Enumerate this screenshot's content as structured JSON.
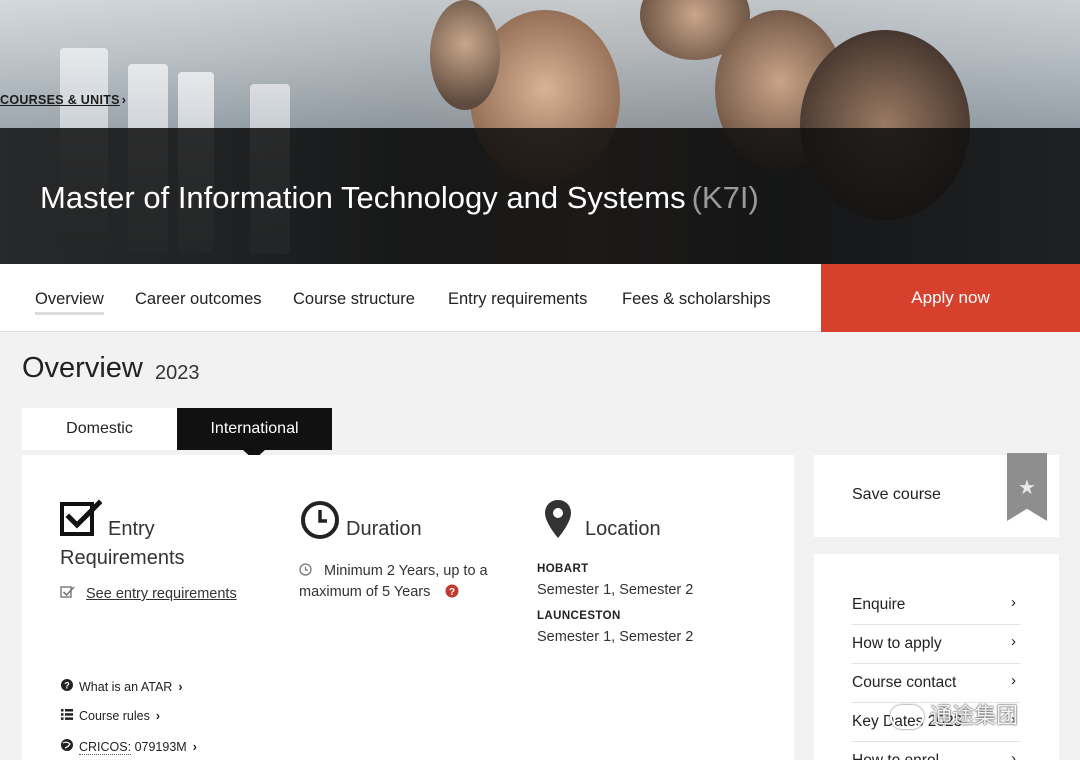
{
  "hero": {
    "breadcrumb": "COURSES & UNITS",
    "breadcrumb_chevron": "›",
    "title": "Master of Information Technology and Systems",
    "code": "(K7I)"
  },
  "nav": {
    "items": [
      "Overview",
      "Career outcomes",
      "Course structure",
      "Entry requirements",
      "Fees & scholarships"
    ],
    "apply_label": "Apply now"
  },
  "overview": {
    "title": "Overview",
    "year": "2023",
    "tabs": {
      "domestic": "Domestic",
      "international": "International"
    },
    "entry": {
      "title_line1": "Entry",
      "title_line2": "Requirements",
      "link": "See entry requirements",
      "icon": "checkbox-icon"
    },
    "duration": {
      "title": "Duration",
      "text_line1": "Minimum 2 Years, up to a",
      "text_line2": "maximum of 5 Years",
      "icon": "clock-icon"
    },
    "location": {
      "title": "Location",
      "icon": "map-pin-icon",
      "campuses": [
        {
          "name": "HOBART",
          "semesters": "Semester 1, Semester 2"
        },
        {
          "name": "LAUNCESTON",
          "semesters": "Semester 1, Semester 2"
        }
      ]
    },
    "mini_links": {
      "atar": "What is an ATAR",
      "rules": "Course rules",
      "cricos_label": "CRICOS:",
      "cricos_value": "079193M"
    }
  },
  "sidebar": {
    "save_label": "Save course",
    "links": [
      "Enquire",
      "How to apply",
      "Course contact",
      "Key Dates 2023",
      "How to enrol"
    ]
  },
  "watermark": "通途集团",
  "colors": {
    "accent": "#d6402d",
    "hero_band": "#0f0f0f",
    "active_tab": "#111111"
  }
}
